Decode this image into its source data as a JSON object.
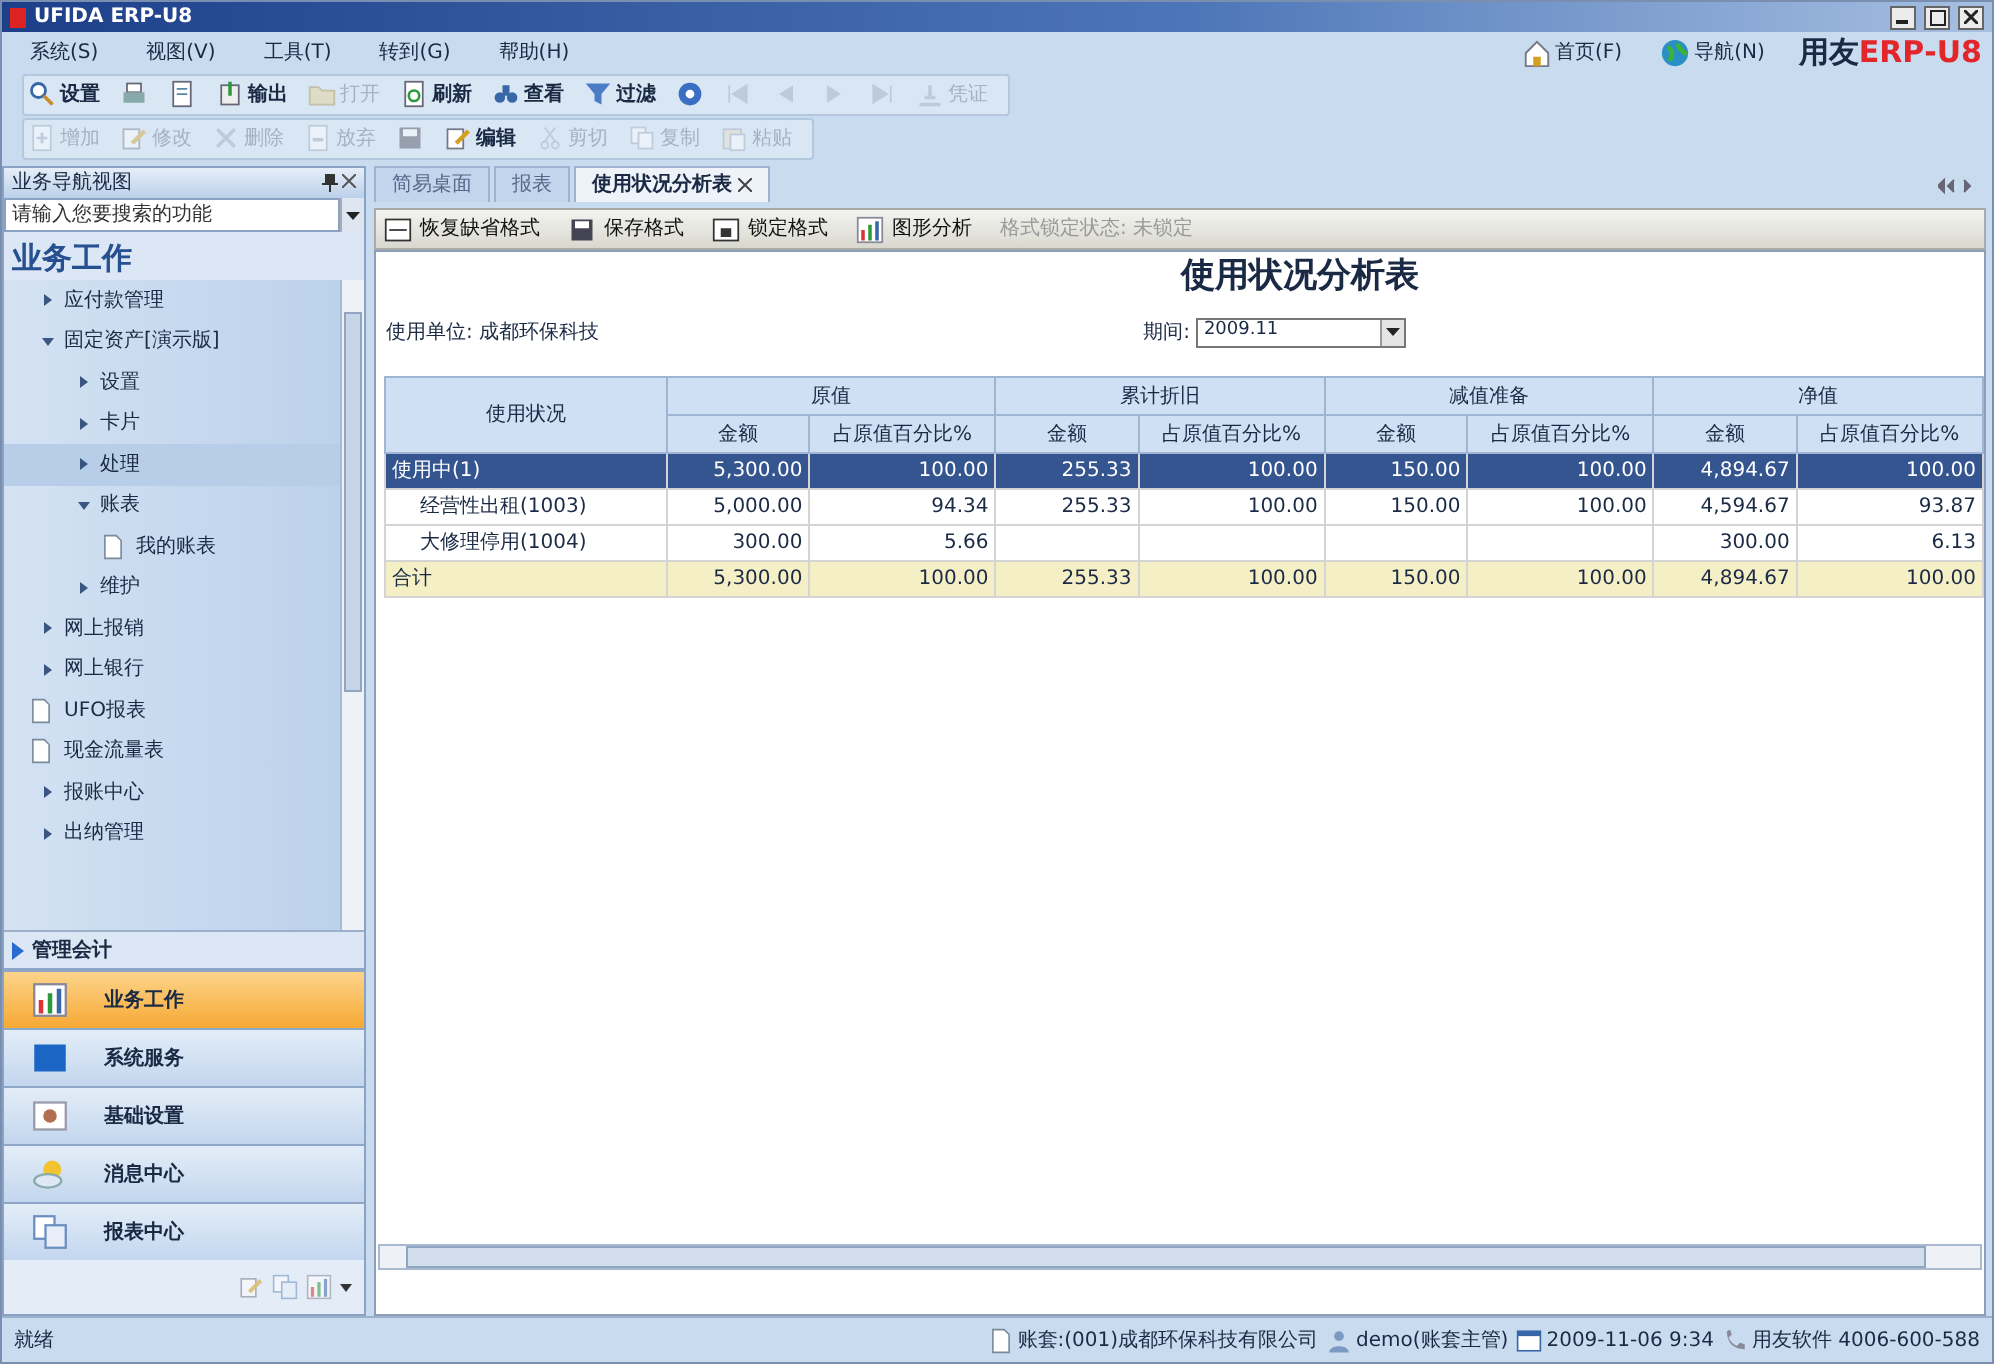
{
  "window": {
    "title": "UFIDA ERP-U8"
  },
  "menu": [
    "系统(S)",
    "视图(V)",
    "工具(T)",
    "转到(G)",
    "帮助(H)"
  ],
  "toolbar_1": [
    {
      "label": "设置",
      "disabled": false
    },
    {
      "disabled": false
    },
    {
      "disabled": false
    },
    {
      "label": "输出",
      "disabled": false
    },
    {
      "label": "打开",
      "disabled": true
    },
    {
      "label": "刷新",
      "disabled": false
    },
    {
      "label": "查看",
      "disabled": false
    },
    {
      "label": "过滤",
      "disabled": false
    },
    {
      "disabled": false
    },
    {
      "disabled": true
    },
    {
      "disabled": true
    },
    {
      "disabled": true
    },
    {
      "disabled": true
    },
    {
      "label": "凭证",
      "disabled": true
    }
  ],
  "toolbar_2": [
    {
      "label": "增加",
      "disabled": true
    },
    {
      "label": "修改",
      "disabled": true
    },
    {
      "label": "删除",
      "disabled": true
    },
    {
      "label": "放弃",
      "disabled": true
    },
    {
      "disabled": true
    },
    {
      "label": "编辑",
      "disabled": false
    },
    {
      "label": "剪切",
      "disabled": true
    },
    {
      "label": "复制",
      "disabled": true
    },
    {
      "label": "粘贴",
      "disabled": true
    }
  ],
  "top_links": [
    "首页(F)",
    "导航(N)"
  ],
  "logo": {
    "brand": "用友",
    "product": "ERP",
    "suffix": "-U8"
  },
  "nav_panel": {
    "title": "业务导航视图",
    "search": {
      "placeholder": "请输入您要搜索的功能"
    },
    "section": "业务工作",
    "tree": [
      {
        "label": "应付款管理",
        "kind": "folder",
        "expanded": false,
        "selected": false
      },
      {
        "label": "固定资产[演示版]",
        "kind": "folder",
        "expanded": true,
        "selected": false,
        "children": [
          {
            "label": "设置",
            "kind": "folder",
            "expanded": false,
            "selected": false
          },
          {
            "label": "卡片",
            "kind": "folder",
            "expanded": false,
            "selected": false
          },
          {
            "label": "处理",
            "kind": "folder",
            "expanded": false,
            "selected": true
          },
          {
            "label": "账表",
            "kind": "folder",
            "expanded": true,
            "selected": false,
            "children": [
              {
                "label": "我的账表",
                "kind": "doc",
                "selected": false
              }
            ]
          },
          {
            "label": "维护",
            "kind": "folder",
            "expanded": false,
            "selected": false
          }
        ]
      },
      {
        "label": "网上报销",
        "kind": "folder",
        "expanded": false,
        "selected": false
      },
      {
        "label": "网上银行",
        "kind": "folder",
        "expanded": false,
        "selected": false
      },
      {
        "label": "UFO报表",
        "kind": "doc",
        "selected": false
      },
      {
        "label": "现金流量表",
        "kind": "doc",
        "selected": false
      },
      {
        "label": "报账中心",
        "kind": "folder",
        "expanded": false,
        "selected": false
      },
      {
        "label": "出纳管理",
        "kind": "folder",
        "expanded": false,
        "selected": false
      }
    ],
    "next_section": "管理会计",
    "modules": [
      {
        "label": "业务工作",
        "selected": true
      },
      {
        "label": "系统服务",
        "selected": false
      },
      {
        "label": "基础设置",
        "selected": false
      },
      {
        "label": "消息中心",
        "selected": false
      },
      {
        "label": "报表中心",
        "selected": false
      }
    ]
  },
  "tabs": [
    {
      "label": "简易桌面",
      "selected": false,
      "closable": false
    },
    {
      "label": "报表",
      "selected": false,
      "closable": false
    },
    {
      "label": "使用状况分析表",
      "selected": true,
      "closable": true
    }
  ],
  "report_toolbar": [
    "恢复缺省格式",
    "保存格式",
    "锁定格式",
    "图形分析"
  ],
  "format_status": "格式锁定状态: 未锁定",
  "report": {
    "title": "使用状况分析表",
    "unit": "使用单位: 成都环保科技",
    "period_label": "期间:",
    "period_value": "2009.11",
    "row_header": "使用状况",
    "groups": [
      {
        "label": "原值",
        "columns": [
          "金额",
          "占原值百分比%"
        ]
      },
      {
        "label": "累计折旧",
        "columns": [
          "金额",
          "占原值百分比%"
        ]
      },
      {
        "label": "减值准备",
        "columns": [
          "金额",
          "占原值百分比%"
        ]
      },
      {
        "label": "净值",
        "columns": [
          "金额",
          "占原值百分比%"
        ]
      }
    ],
    "rows": [
      {
        "label": "使用中(1)",
        "selected": true,
        "cells": [
          "5,300.00",
          "100.00",
          "255.33",
          "100.00",
          "150.00",
          "100.00",
          "4,894.67",
          "100.00"
        ],
        "children": [
          {
            "label": "经营性出租(1003)",
            "selected": false,
            "cells": [
              "5,000.00",
              "94.34",
              "255.33",
              "100.00",
              "150.00",
              "100.00",
              "4,594.67",
              "93.87"
            ]
          },
          {
            "label": "大修理停用(1004)",
            "selected": false,
            "cells": [
              "300.00",
              "5.66",
              null,
              null,
              null,
              null,
              "300.00",
              "6.13"
            ]
          }
        ]
      }
    ],
    "total": {
      "label": "合计",
      "cells": [
        "5,300.00",
        "100.00",
        "255.33",
        "100.00",
        "150.00",
        "100.00",
        "4,894.67",
        "100.00"
      ]
    }
  },
  "status_bar": {
    "state": "就绪",
    "account": "账套:(001)成都环保科技有限公司",
    "user": "demo(账套主管)",
    "datetime": "2009-11-06 9:34",
    "vendor": "用友软件 4006-600-588"
  }
}
